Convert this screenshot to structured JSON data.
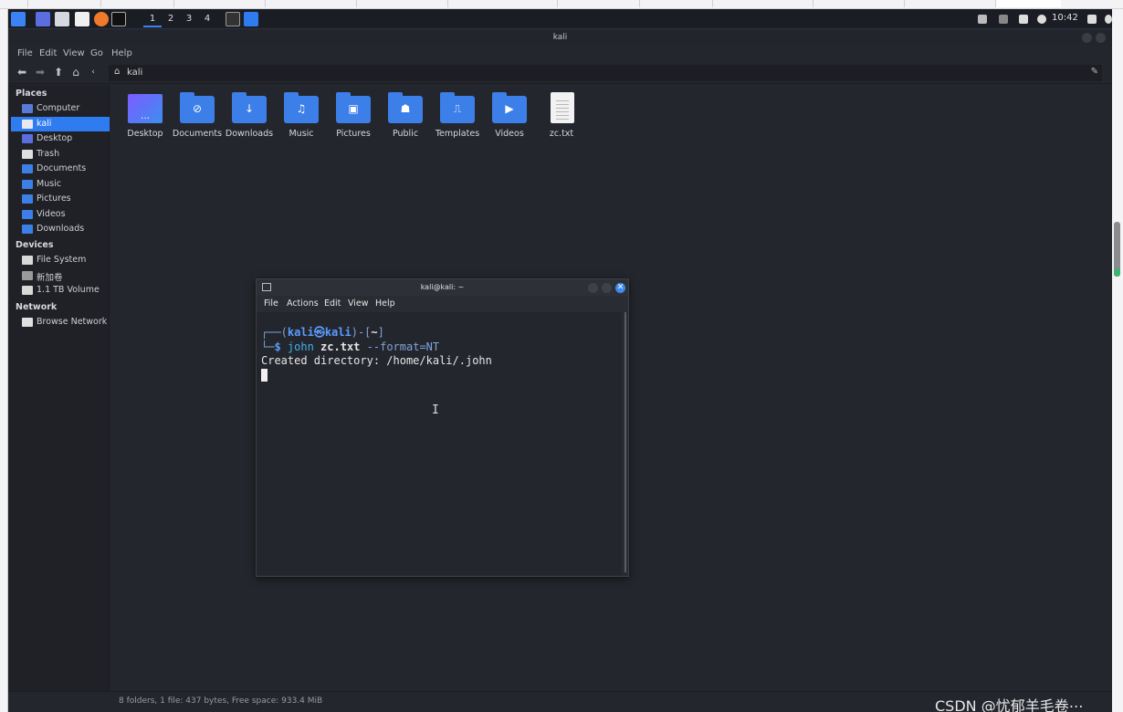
{
  "panel": {
    "workspaces": [
      "1",
      "2",
      "3",
      "4"
    ],
    "clock": "10:42"
  },
  "file_manager": {
    "title": "kali",
    "menu": [
      "File",
      "Edit",
      "View",
      "Go",
      "Help"
    ],
    "location": "kali",
    "sidebar": {
      "places_heading": "Places",
      "places": [
        {
          "label": "Computer",
          "icon": "computer-icon",
          "color": "#5a7ad8"
        },
        {
          "label": "kali",
          "icon": "home-folder-icon",
          "color": "#e8e8f0",
          "selected": true
        },
        {
          "label": "Desktop",
          "icon": "desktop-icon",
          "color": "#5b6ee0"
        },
        {
          "label": "Trash",
          "icon": "trash-icon",
          "color": "#e0e0e0"
        },
        {
          "label": "Documents",
          "icon": "documents-folder-icon",
          "color": "#3d7fe8"
        },
        {
          "label": "Music",
          "icon": "music-folder-icon",
          "color": "#3d7fe8"
        },
        {
          "label": "Pictures",
          "icon": "pictures-folder-icon",
          "color": "#3d7fe8"
        },
        {
          "label": "Videos",
          "icon": "videos-folder-icon",
          "color": "#3d7fe8"
        },
        {
          "label": "Downloads",
          "icon": "downloads-folder-icon",
          "color": "#3d7fe8"
        }
      ],
      "devices_heading": "Devices",
      "devices": [
        {
          "label": "File System",
          "icon": "drive-icon",
          "color": "#d8d8d8"
        },
        {
          "label": "新加卷",
          "icon": "drive-icon",
          "color": "#9a9a9a"
        },
        {
          "label": "1.1 TB Volume",
          "icon": "drive-icon",
          "color": "#d8d8d8"
        }
      ],
      "network_heading": "Network",
      "network": [
        {
          "label": "Browse Network",
          "icon": "network-icon",
          "color": "#e0e0e0"
        }
      ]
    },
    "items": [
      {
        "label": "Desktop",
        "icon": "desktop-folder-icon",
        "glyph": "…"
      },
      {
        "label": "Documents",
        "icon": "documents-folder-icon",
        "glyph": "⊘"
      },
      {
        "label": "Downloads",
        "icon": "downloads-folder-icon",
        "glyph": "↓"
      },
      {
        "label": "Music",
        "icon": "music-folder-icon",
        "glyph": "♫"
      },
      {
        "label": "Pictures",
        "icon": "pictures-folder-icon",
        "glyph": "▣"
      },
      {
        "label": "Public",
        "icon": "public-folder-icon",
        "glyph": "☗"
      },
      {
        "label": "Templates",
        "icon": "templates-folder-icon",
        "glyph": "⎍"
      },
      {
        "label": "Videos",
        "icon": "videos-folder-icon",
        "glyph": "▶"
      },
      {
        "label": "zc.txt",
        "icon": "text-file-icon",
        "glyph": ""
      }
    ],
    "status": "8 folders, 1 file: 437 bytes, Free space: 933.4 MiB"
  },
  "terminal": {
    "title": "kali@kali: ~",
    "menu": [
      "File",
      "Actions",
      "Edit",
      "View",
      "Help"
    ],
    "prompt_user": "kali",
    "prompt_at": "㉿",
    "prompt_host": "kali",
    "prompt_dir": "~",
    "command": "john",
    "command_arg": "zc.txt",
    "command_opt": "--format=NT",
    "output": "Created directory: /home/kali/.john"
  },
  "watermark": "CSDN @忧郁羊毛卷⋯"
}
